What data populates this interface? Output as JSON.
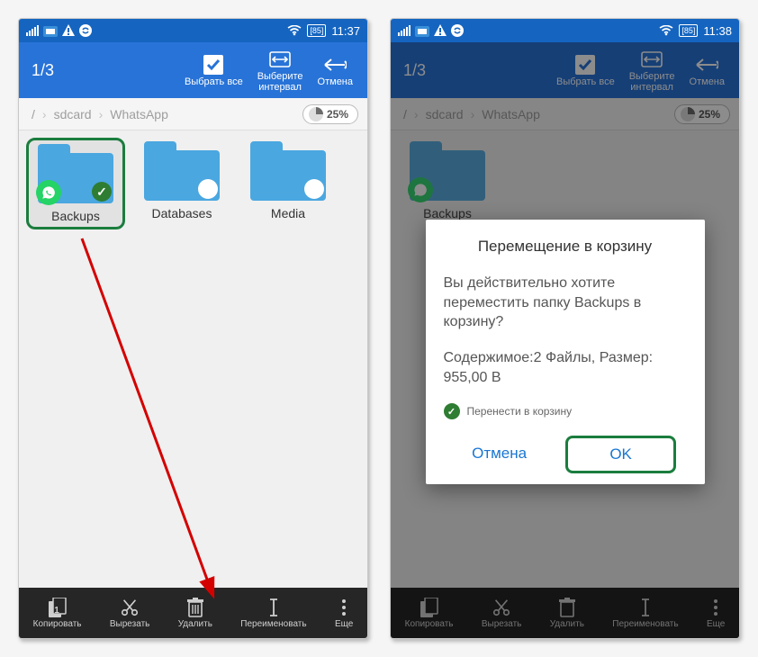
{
  "left": {
    "status_time": "11:37",
    "battery": "85",
    "selection": "1/3",
    "toolbar": {
      "select_all": "Выбрать все",
      "range": "Выберите\nинтервал",
      "cancel": "Отмена"
    },
    "breadcrumb": [
      "/",
      "sdcard",
      "WhatsApp"
    ],
    "storage_percent": "25%",
    "folders": [
      {
        "name": "Backups",
        "selected": true,
        "highlighted": true,
        "has_whatsapp_badge": true
      },
      {
        "name": "Databases",
        "selected": false
      },
      {
        "name": "Media",
        "selected": false
      }
    ],
    "bottom": {
      "copy": "Копировать",
      "cut": "Вырезать",
      "delete": "Удалить",
      "rename": "Переименовать",
      "more": "Еще"
    }
  },
  "right": {
    "status_time": "11:38",
    "battery": "85",
    "selection": "1/3",
    "toolbar": {
      "select_all": "Выбрать все",
      "range": "Выберите\nинтервал",
      "cancel": "Отмена"
    },
    "breadcrumb": [
      "/",
      "sdcard",
      "WhatsApp"
    ],
    "storage_percent": "25%",
    "folders": [
      {
        "name": "Backups"
      }
    ],
    "dialog": {
      "title": "Перемещение в корзину",
      "message": "Вы действительно хотите переместить папку Backups в корзину?",
      "details": "Содержимое:2 Файлы, Размер: 955,00 B",
      "trash_option": "Перенести в корзину",
      "cancel": "Отмена",
      "ok": "OK"
    },
    "bottom": {
      "copy": "Копировать",
      "cut": "Вырезать",
      "delete": "Удалить",
      "rename": "Переименовать",
      "more": "Еще"
    }
  }
}
